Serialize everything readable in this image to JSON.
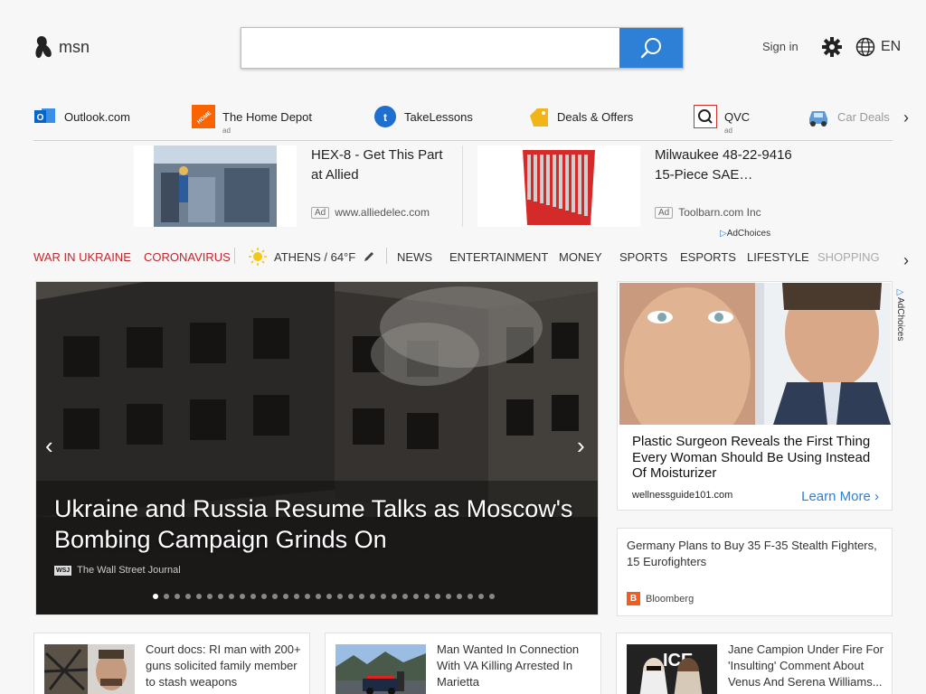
{
  "header": {
    "logo_text": "msn",
    "search_placeholder": "",
    "signin": "Sign in",
    "language": "EN"
  },
  "quicklinks": [
    {
      "label": "Outlook.com",
      "sub": "",
      "icon": "outlook-icon"
    },
    {
      "label": "The Home Depot",
      "sub": "ad",
      "icon": "home-depot-icon"
    },
    {
      "label": "TakeLessons",
      "sub": "",
      "icon": "takelessons-icon"
    },
    {
      "label": "Deals & Offers",
      "sub": "",
      "icon": "deals-tag-icon"
    },
    {
      "label": "QVC",
      "sub": "ad",
      "icon": "qvc-icon"
    },
    {
      "label": "Car Deals",
      "sub": "",
      "icon": "car-icon"
    }
  ],
  "ads": [
    {
      "title": "HEX-8 - Get This Part at Allied",
      "tag": "Ad",
      "source": "www.alliedelec.com"
    },
    {
      "title": "Milwaukee 48-22-9416 15-Piece SAE…",
      "tag": "Ad",
      "source": "Toolbarn.com Inc"
    }
  ],
  "adchoices": "AdChoices",
  "nav": {
    "war": "WAR IN UKRAINE",
    "corona": "CORONAVIRUS",
    "weather": "ATHENS / 64°F",
    "items": [
      "NEWS",
      "ENTERTAINMENT",
      "MONEY",
      "SPORTS",
      "ESPORTS",
      "LIFESTYLE",
      "SHOPPING"
    ]
  },
  "hero": {
    "title": "Ukraine and Russia Resume Talks as Moscow's Bombing Campaign Grinds On",
    "source": "The Wall Street Journal",
    "source_badge": "WSJ",
    "slides": 32,
    "active_slide": 0
  },
  "right_ad": {
    "title": "Plastic Surgeon Reveals the First Thing Every Woman Should Be Using Instead Of Moisturizer",
    "source": "wellnessguide101.com",
    "cta": "Learn More"
  },
  "side_story": {
    "title": "Germany Plans to Buy 35 F-35 Stealth Fighters, 15 Eurofighters",
    "source": "Bloomberg",
    "source_badge": "B"
  },
  "stories": [
    {
      "title": "Court docs: RI man with 200+ guns solicited family member to stash weapons"
    },
    {
      "title": "Man Wanted In Connection With VA Killing Arrested In Marietta"
    },
    {
      "title": "Jane Campion Under Fire For 'Insulting' Comment About Venus And Serena Williams..."
    }
  ],
  "colors": {
    "accent": "#2e7fd6",
    "nav_red": "#c1272d"
  }
}
